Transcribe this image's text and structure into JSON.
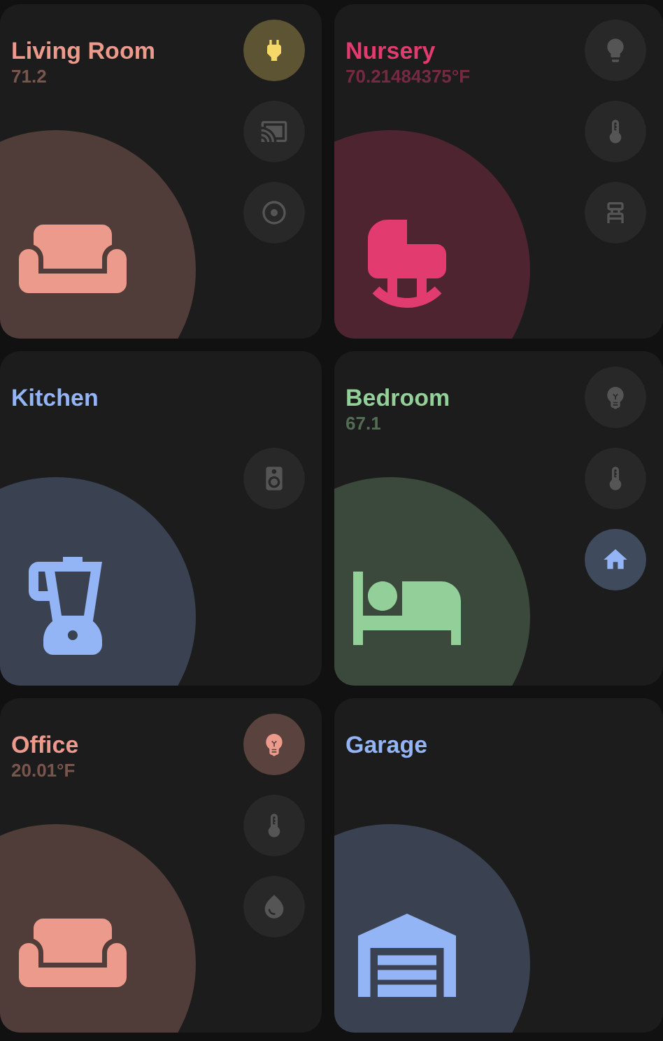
{
  "rooms": [
    {
      "name": "Living Room",
      "subtitle": "71.2",
      "color": "#ec9a8c",
      "kind": "sofa",
      "buttons": [
        {
          "kind": "plug",
          "on": true,
          "color": "#f5d867"
        },
        {
          "kind": "cast",
          "on": false
        },
        {
          "kind": "vacuum",
          "on": false
        }
      ]
    },
    {
      "name": "Nursery",
      "subtitle": "70.21484375°F",
      "color": "#e23b6f",
      "kind": "crib",
      "buttons": [
        {
          "kind": "bulb",
          "on": false
        },
        {
          "kind": "thermometer",
          "on": false
        },
        {
          "kind": "chair",
          "on": false
        }
      ]
    },
    {
      "name": "Kitchen",
      "color": "#93b4f5",
      "kind": "blender",
      "buttons": [
        {
          "kind": "speaker",
          "on": false
        }
      ]
    },
    {
      "name": "Bedroom",
      "subtitle": "67.1",
      "color": "#93cf98",
      "kind": "bed",
      "buttons": [
        {
          "kind": "lamp",
          "on": false
        },
        {
          "kind": "thermometer",
          "on": false
        },
        {
          "kind": "home",
          "on": true,
          "color": "#93b4f5"
        }
      ]
    },
    {
      "name": "Office",
      "subtitle": "20.01°F",
      "color": "#ec9a8c",
      "kind": "sofa",
      "buttons": [
        {
          "kind": "lamp",
          "on": true,
          "color": "#ec9a8c"
        },
        {
          "kind": "thermometer",
          "on": false
        },
        {
          "kind": "drop",
          "on": false
        }
      ]
    },
    {
      "name": "Garage",
      "color": "#93b4f5",
      "kind": "garage"
    }
  ]
}
